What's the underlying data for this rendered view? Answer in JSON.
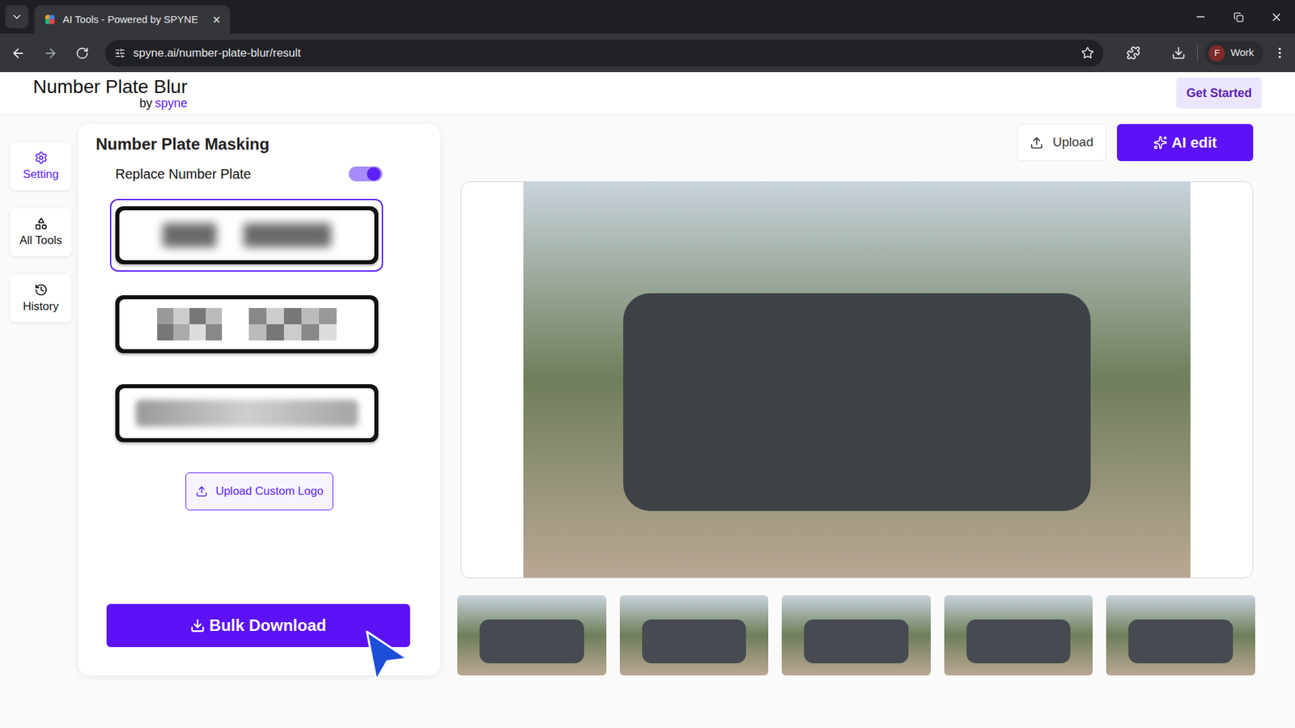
{
  "browser": {
    "tab_title": "AI Tools - Powered by SPYNE",
    "tab_close": "×",
    "url": "spyne.ai/number-plate-blur/result",
    "profile": {
      "initial": "F",
      "name": "Work"
    }
  },
  "app": {
    "title": "Number Plate Blur",
    "byline": "by",
    "brand": "spyne",
    "get_started": "Get Started"
  },
  "sidebar": {
    "items": [
      {
        "label": "Setting",
        "icon": "gear",
        "selected": true
      },
      {
        "label": "All Tools",
        "icon": "shapes",
        "selected": false
      },
      {
        "label": "History",
        "icon": "history",
        "selected": false
      }
    ]
  },
  "panel": {
    "title": "Number Plate Masking",
    "toggle": {
      "label": "Replace Number Plate",
      "on": true
    },
    "plates": [
      {
        "kind": "blur",
        "selected": true
      },
      {
        "kind": "pixelate",
        "selected": false
      },
      {
        "kind": "smudge",
        "selected": false
      }
    ],
    "upload_logo": "Upload Custom Logo",
    "bulk_download": "Bulk Download"
  },
  "toolbar": {
    "upload": "Upload",
    "ai_edit": "AI edit"
  },
  "thumbnails": [
    {
      "selected": false
    },
    {
      "selected": false
    },
    {
      "selected": false
    },
    {
      "selected": false
    },
    {
      "selected": false
    }
  ]
}
